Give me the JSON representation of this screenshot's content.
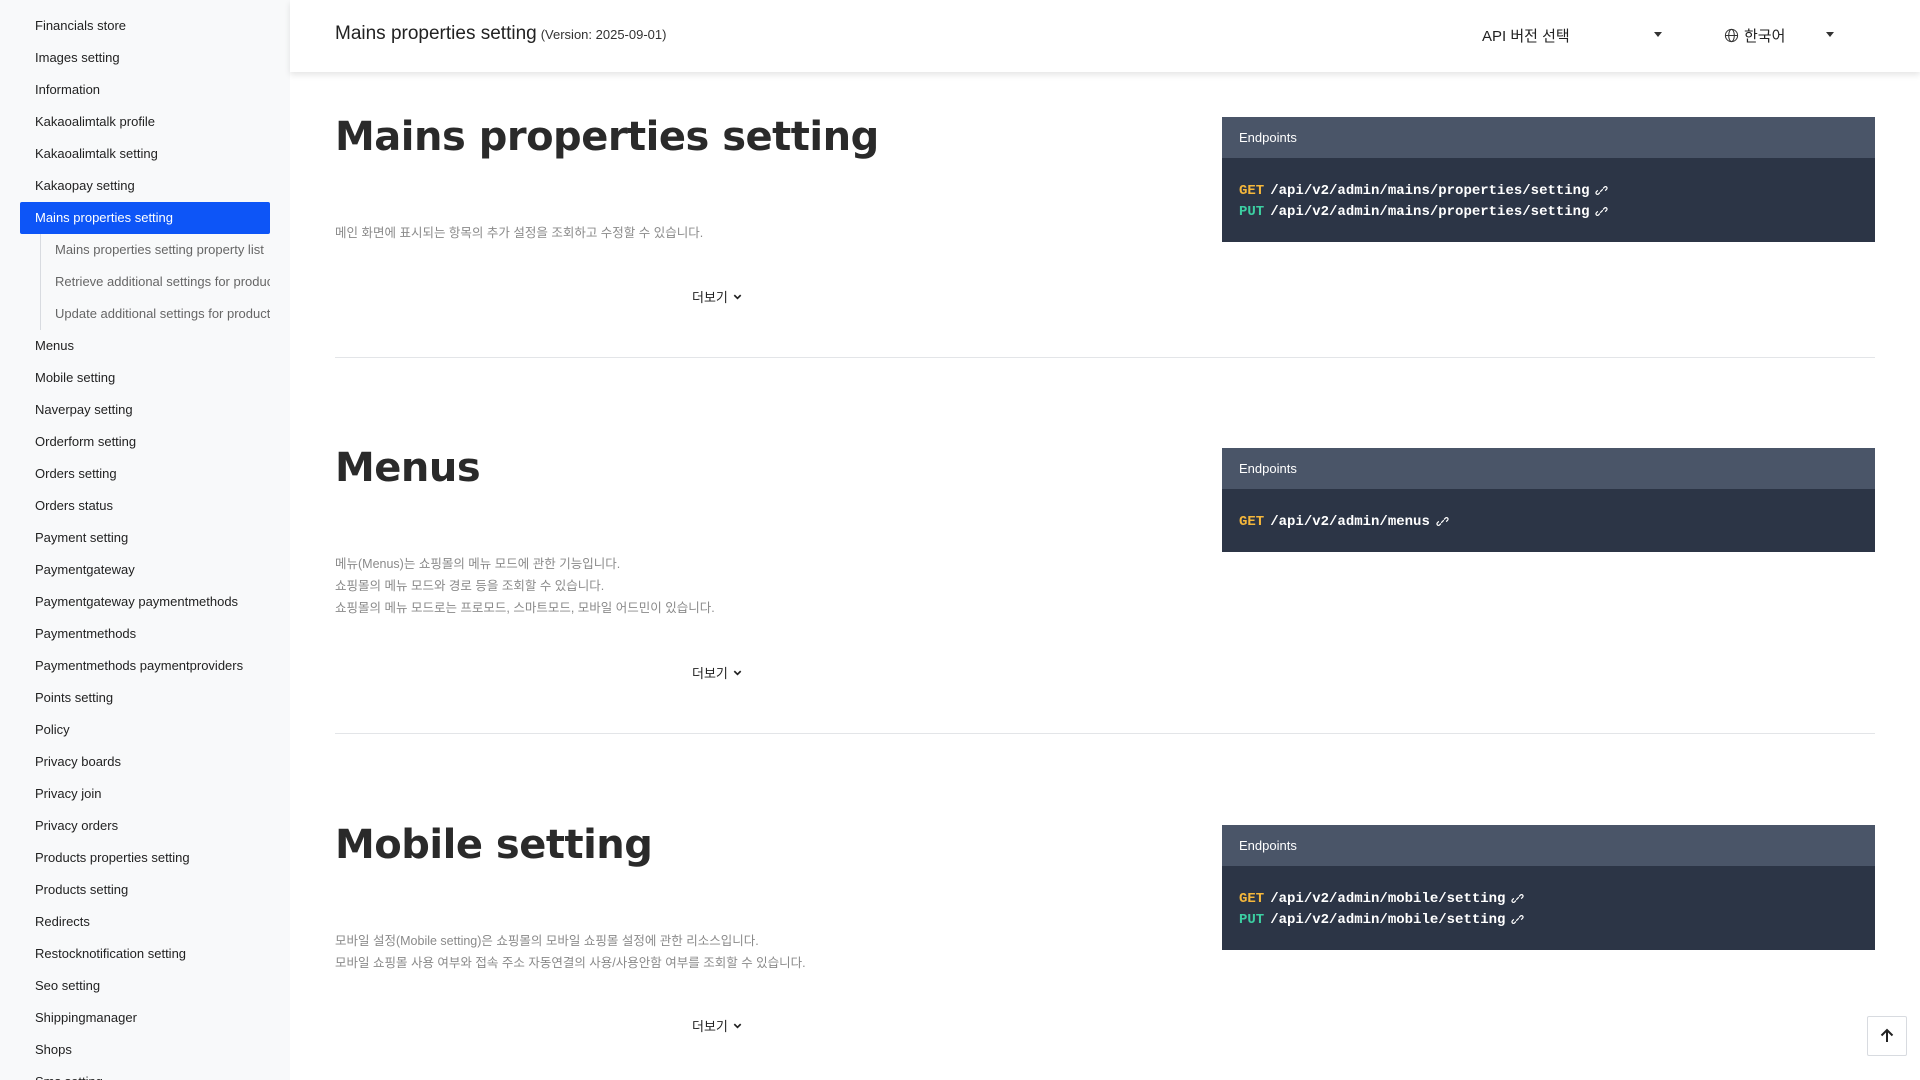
{
  "sidebar": {
    "items_before": [
      "Financials store",
      "Images setting",
      "Information",
      "Kakaoalimtalk profile",
      "Kakaoalimtalk setting",
      "Kakaopay setting"
    ],
    "active_item": "Mains properties setting",
    "sub_items": [
      "Mains properties setting property list",
      "Retrieve additional settings for products",
      "Update additional settings for products"
    ],
    "items_after": [
      "Menus",
      "Mobile setting",
      "Naverpay setting",
      "Orderform setting",
      "Orders setting",
      "Orders status",
      "Payment setting",
      "Paymentgateway",
      "Paymentgateway paymentmethods",
      "Paymentmethods",
      "Paymentmethods paymentproviders",
      "Points setting",
      "Policy",
      "Privacy boards",
      "Privacy join",
      "Privacy orders",
      "Products properties setting",
      "Products setting",
      "Redirects",
      "Restocknotification setting",
      "Seo setting",
      "Shippingmanager",
      "Shops",
      "Sms setting"
    ]
  },
  "header": {
    "title": "Mains properties setting",
    "version": "(Version: 2025-09-01)",
    "api_select_label": "API 버전 선택",
    "language_label": "한국어"
  },
  "sections": [
    {
      "title": "Mains properties setting",
      "description": [
        "메인 화면에 표시되는 항목의 추가 설정을 조회하고 수정할 수 있습니다."
      ],
      "more_label": "더보기",
      "endpoints_label": "Endpoints",
      "endpoints": [
        {
          "method": "GET",
          "path": "/api/v2/admin/mains/properties/setting"
        },
        {
          "method": "PUT",
          "path": "/api/v2/admin/mains/properties/setting"
        }
      ]
    },
    {
      "title": "Menus",
      "description": [
        "메뉴(Menus)는 쇼핑몰의 메뉴 모드에 관한 기능입니다.",
        "쇼핑몰의 메뉴 모드와 경로 등을 조회할 수 있습니다.",
        "쇼핑몰의 메뉴 모드로는 프로모드, 스마트모드, 모바일 어드민이 있습니다."
      ],
      "more_label": "더보기",
      "endpoints_label": "Endpoints",
      "endpoints": [
        {
          "method": "GET",
          "path": "/api/v2/admin/menus"
        }
      ]
    },
    {
      "title": "Mobile setting",
      "description": [
        "모바일 설정(Mobile setting)은 쇼핑몰의 모바일 쇼핑몰 설정에 관한 리소스입니다.",
        "모바일 쇼핑몰 사용 여부와 접속 주소 자동연결의 사용/사용안함 여부를 조회할 수 있습니다."
      ],
      "more_label": "더보기",
      "endpoints_label": "Endpoints",
      "endpoints": [
        {
          "method": "GET",
          "path": "/api/v2/admin/mobile/setting"
        },
        {
          "method": "PUT",
          "path": "/api/v2/admin/mobile/setting"
        }
      ]
    }
  ],
  "colors": {
    "accent": "#0d55f7",
    "get_method": "#f5b73b",
    "put_method": "#3ccfa2",
    "endpoint_header": "#4a5568",
    "endpoint_body": "#2c3546"
  }
}
